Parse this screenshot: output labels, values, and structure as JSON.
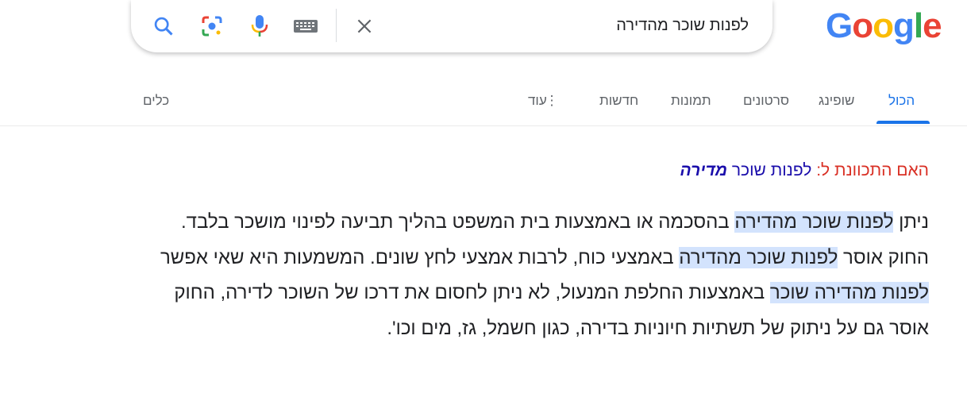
{
  "logo": {
    "letters": [
      "G",
      "o",
      "o",
      "g",
      "l",
      "e"
    ],
    "colors": [
      "#4285f4",
      "#ea4335",
      "#fbbc05",
      "#4285f4",
      "#34a853",
      "#ea4335"
    ]
  },
  "search": {
    "query": "לפנות שוכר מהדירה"
  },
  "icons": {
    "clear": "close-icon",
    "keyboard": "keyboard-icon",
    "mic": "mic-icon",
    "lens": "lens-icon",
    "search": "search-icon"
  },
  "tabs": {
    "all": "הכול",
    "shopping": "שופינג",
    "videos": "סרטונים",
    "images": "תמונות",
    "news": "חדשות",
    "more": "עוד",
    "tools": "כלים"
  },
  "did_you_mean": {
    "label": "האם התכוונת ל:",
    "plain": "לפנות שוכר",
    "bold": "מדירה"
  },
  "snippet": {
    "p1": "ניתן ",
    "h1": "לפנות שוכר מהדירה",
    "p2": " בהסכמה או באמצעות בית המשפט בהליך תביעה לפינוי מושכר בלבד. החוק אוסר ",
    "h2": "לפנות שוכר מהדירה",
    "p3": " באמצעי כוח, לרבות אמצעי לחץ שונים. המשמעות היא שאי אפשר ",
    "h3": "לפנות מהדירה שוכר",
    "p4": " באמצעות החלפת המנעול, לא ניתן לחסום את דרכו של השוכר לדירה, החוק אוסר גם על ניתוק של תשתיות חיוניות בדירה, כגון חשמל, גז, מים וכו'."
  }
}
